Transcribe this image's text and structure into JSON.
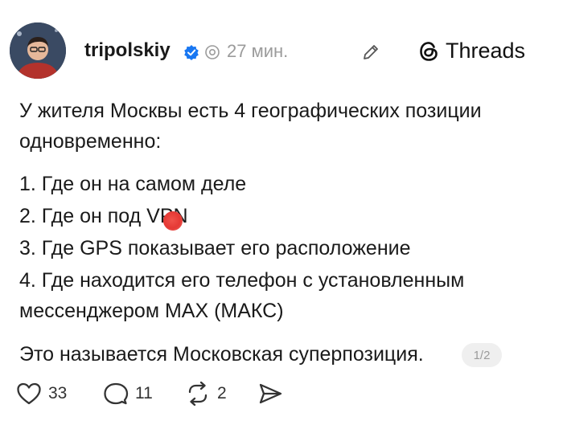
{
  "post": {
    "author": {
      "username": "tripolskiy",
      "avatar_icon": "avatar-photo",
      "verified_icon": "verified-badge-icon"
    },
    "time": "27 мин.",
    "brand": {
      "label": "Threads",
      "icon": "threads-logo-icon"
    },
    "lines": [
      "У жителя Москвы есть 4 географических позиции",
      "одновременно:",
      "1. Где он на самом деле",
      "2. Где он под VPN",
      "3. Где GPS показывает его расположение",
      "4. Где находится его телефон с установленным",
      "мессенджером MAX (МАКС)",
      "Это называется Московская суперпозиция."
    ],
    "page_indicator": "1/2"
  },
  "actions": {
    "likes": "33",
    "replies": "11",
    "reposts": "2"
  },
  "colors": {
    "verified": "#1877f2",
    "muted": "#9b9b9b",
    "red_dot": "#e53935"
  }
}
